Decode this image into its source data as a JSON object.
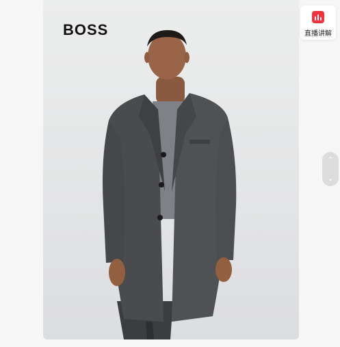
{
  "product": {
    "brand": "BOSS"
  },
  "live_widget": {
    "label": "直播讲解",
    "icon": "live-bars-icon",
    "accent": "#f0323c"
  },
  "pager": {
    "up_icon": "chevron-up-icon",
    "down_icon": "chevron-down-icon",
    "up_glyph": "⌃",
    "down_glyph": "⌄"
  }
}
